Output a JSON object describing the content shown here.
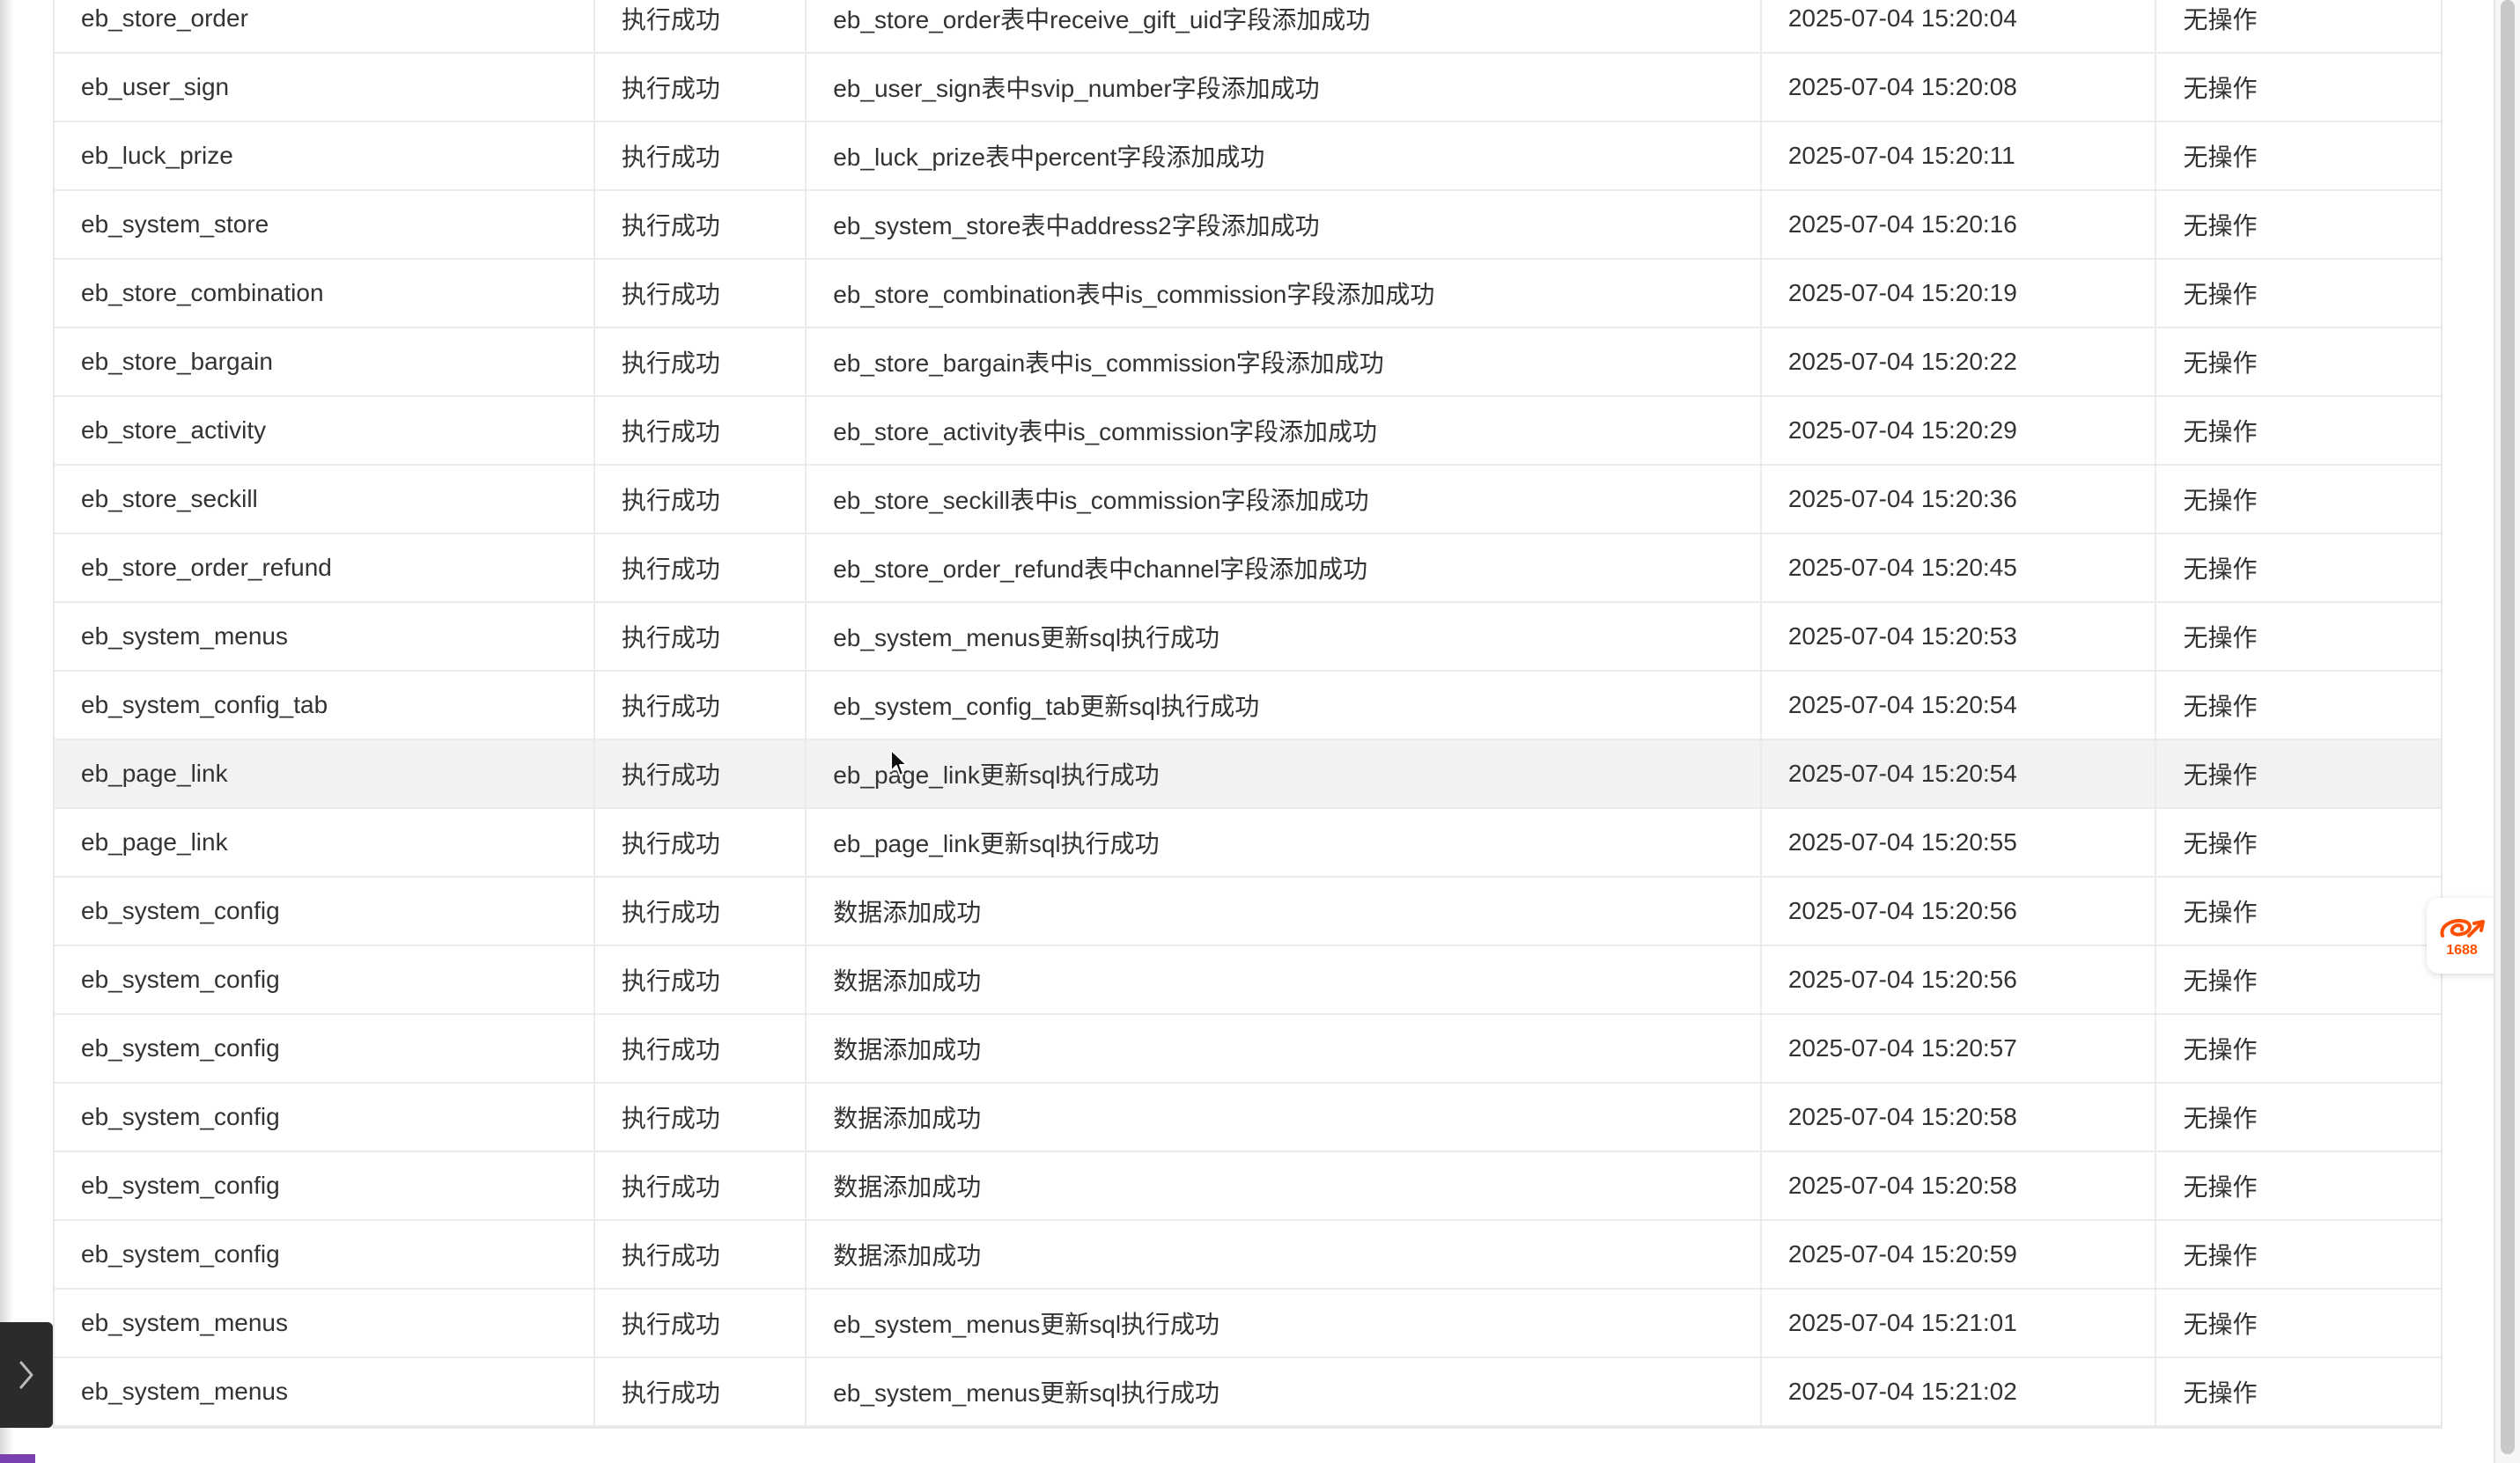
{
  "table": {
    "rows": [
      {
        "table": "eb_store_order",
        "status": "执行成功",
        "message": "eb_store_order表中receive_gift_uid字段添加成功",
        "time": "2025-07-04 15:20:04",
        "action": "无操作"
      },
      {
        "table": "eb_user_sign",
        "status": "执行成功",
        "message": "eb_user_sign表中svip_number字段添加成功",
        "time": "2025-07-04 15:20:08",
        "action": "无操作"
      },
      {
        "table": "eb_luck_prize",
        "status": "执行成功",
        "message": "eb_luck_prize表中percent字段添加成功",
        "time": "2025-07-04 15:20:11",
        "action": "无操作"
      },
      {
        "table": "eb_system_store",
        "status": "执行成功",
        "message": "eb_system_store表中address2字段添加成功",
        "time": "2025-07-04 15:20:16",
        "action": "无操作"
      },
      {
        "table": "eb_store_combination",
        "status": "执行成功",
        "message": "eb_store_combination表中is_commission字段添加成功",
        "time": "2025-07-04 15:20:19",
        "action": "无操作"
      },
      {
        "table": "eb_store_bargain",
        "status": "执行成功",
        "message": "eb_store_bargain表中is_commission字段添加成功",
        "time": "2025-07-04 15:20:22",
        "action": "无操作"
      },
      {
        "table": "eb_store_activity",
        "status": "执行成功",
        "message": "eb_store_activity表中is_commission字段添加成功",
        "time": "2025-07-04 15:20:29",
        "action": "无操作"
      },
      {
        "table": "eb_store_seckill",
        "status": "执行成功",
        "message": "eb_store_seckill表中is_commission字段添加成功",
        "time": "2025-07-04 15:20:36",
        "action": "无操作"
      },
      {
        "table": "eb_store_order_refund",
        "status": "执行成功",
        "message": "eb_store_order_refund表中channel字段添加成功",
        "time": "2025-07-04 15:20:45",
        "action": "无操作"
      },
      {
        "table": "eb_system_menus",
        "status": "执行成功",
        "message": "eb_system_menus更新sql执行成功",
        "time": "2025-07-04 15:20:53",
        "action": "无操作"
      },
      {
        "table": "eb_system_config_tab",
        "status": "执行成功",
        "message": "eb_system_config_tab更新sql执行成功",
        "time": "2025-07-04 15:20:54",
        "action": "无操作"
      },
      {
        "table": "eb_page_link",
        "status": "执行成功",
        "message": "eb_page_link更新sql执行成功",
        "time": "2025-07-04 15:20:54",
        "action": "无操作"
      },
      {
        "table": "eb_page_link",
        "status": "执行成功",
        "message": "eb_page_link更新sql执行成功",
        "time": "2025-07-04 15:20:55",
        "action": "无操作"
      },
      {
        "table": "eb_system_config",
        "status": "执行成功",
        "message": "数据添加成功",
        "time": "2025-07-04 15:20:56",
        "action": "无操作"
      },
      {
        "table": "eb_system_config",
        "status": "执行成功",
        "message": "数据添加成功",
        "time": "2025-07-04 15:20:56",
        "action": "无操作"
      },
      {
        "table": "eb_system_config",
        "status": "执行成功",
        "message": "数据添加成功",
        "time": "2025-07-04 15:20:57",
        "action": "无操作"
      },
      {
        "table": "eb_system_config",
        "status": "执行成功",
        "message": "数据添加成功",
        "time": "2025-07-04 15:20:58",
        "action": "无操作"
      },
      {
        "table": "eb_system_config",
        "status": "执行成功",
        "message": "数据添加成功",
        "time": "2025-07-04 15:20:58",
        "action": "无操作"
      },
      {
        "table": "eb_system_config",
        "status": "执行成功",
        "message": "数据添加成功",
        "time": "2025-07-04 15:20:59",
        "action": "无操作"
      },
      {
        "table": "eb_system_menus",
        "status": "执行成功",
        "message": "eb_system_menus更新sql执行成功",
        "time": "2025-07-04 15:21:01",
        "action": "无操作"
      },
      {
        "table": "eb_system_menus",
        "status": "执行成功",
        "message": "eb_system_menus更新sql执行成功",
        "time": "2025-07-04 15:21:02",
        "action": "无操作"
      }
    ]
  },
  "badge": {
    "label": "1688",
    "icon": "alibaba-1688-icon",
    "brand_color": "#ff5000"
  },
  "side_toggle": {
    "icon": "chevron-right-icon"
  }
}
